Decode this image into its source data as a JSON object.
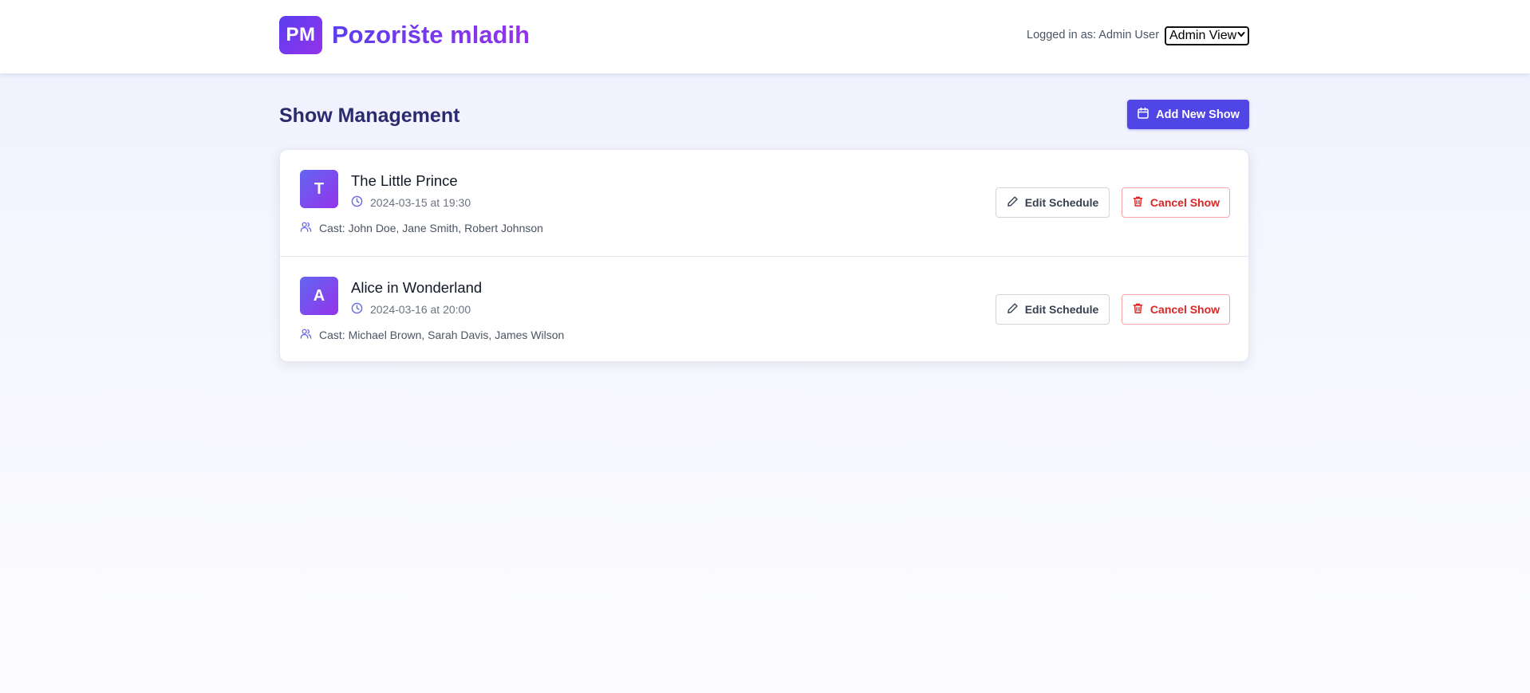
{
  "header": {
    "logo_text": "PM",
    "brand": "Pozorište mladih",
    "logged_in": "Logged in as: Admin User",
    "view_select": {
      "selected": "Admin View"
    }
  },
  "main": {
    "title": "Show Management",
    "add_button": "Add New Show"
  },
  "shows": [
    {
      "initial": "T",
      "title": "The Little Prince",
      "datetime": "2024-03-15 at 19:30",
      "cast": "Cast: John Doe, Jane Smith, Robert Johnson",
      "edit_label": "Edit Schedule",
      "cancel_label": "Cancel Show"
    },
    {
      "initial": "A",
      "title": "Alice in Wonderland",
      "datetime": "2024-03-16 at 20:00",
      "cast": "Cast: Michael Brown, Sarah Davis, James Wilson",
      "edit_label": "Edit Schedule",
      "cancel_label": "Cancel Show"
    }
  ],
  "icons": {
    "add": "calendar-icon",
    "time": "clock-icon",
    "cast": "users-icon",
    "edit": "pencil-icon",
    "cancel": "trash-icon"
  },
  "colors": {
    "primary": "#4f46e5",
    "brand_gradient_start": "#5b3df0",
    "brand_gradient_end": "#9333ea",
    "danger": "#dc2626",
    "heading": "#2a2a6e"
  }
}
